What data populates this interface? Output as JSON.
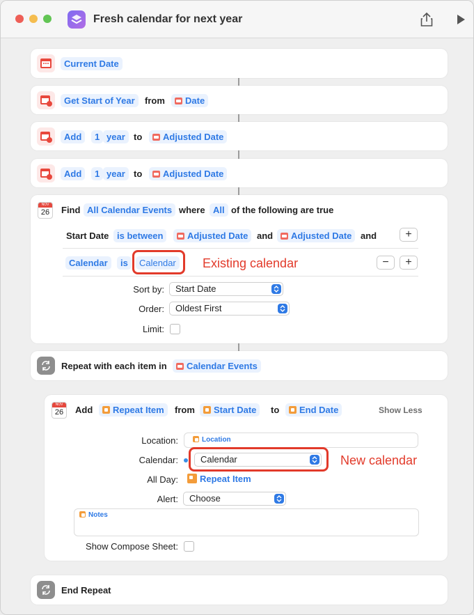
{
  "window": {
    "title": "Fresh calendar for next year"
  },
  "actions": {
    "current_date": "Current Date",
    "get_start": {
      "action": "Get Start of Year",
      "from": "from",
      "input": "Date"
    },
    "add1": {
      "add": "Add",
      "qty": "1",
      "unit": "year",
      "to": "to",
      "target": "Adjusted Date"
    },
    "add2": {
      "add": "Add",
      "qty": "1",
      "unit": "year",
      "to": "to",
      "target": "Adjusted Date"
    },
    "find": {
      "find": "Find",
      "subject": "All Calendar Events",
      "where": "where",
      "all": "All",
      "suffix": "of the following are true",
      "cond1": {
        "field": "Start Date",
        "op": "is between",
        "a": "Adjusted Date",
        "and": "and",
        "b": "Adjusted Date",
        "trail": "and"
      },
      "cond2": {
        "field": "Calendar",
        "op": "is",
        "value": "Calendar"
      },
      "sort_label": "Sort by:",
      "sort_value": "Start Date",
      "order_label": "Order:",
      "order_value": "Oldest First",
      "limit_label": "Limit:",
      "plus": "+",
      "minus": "−",
      "badge_month": "NOV",
      "badge_day": "26"
    },
    "repeat": {
      "label": "Repeat with each item in",
      "token": "Calendar Events"
    },
    "add_event": {
      "add": "Add",
      "item": "Repeat Item",
      "from": "from",
      "start": "Start Date",
      "to": "to",
      "end": "End Date",
      "show_less": "Show Less",
      "location_label": "Location:",
      "location_placeholder": "Location",
      "calendar_label": "Calendar:",
      "calendar_value": "Calendar",
      "allday_label": "All Day:",
      "allday_value": "Repeat Item",
      "alert_label": "Alert:",
      "alert_value": "Choose",
      "notes_placeholder": "Notes",
      "compose_label": "Show Compose Sheet:",
      "badge_month": "NOV",
      "badge_day": "26"
    },
    "end_repeat": "End Repeat"
  },
  "annotations": {
    "existing": "Existing calendar",
    "new": "New calendar"
  },
  "colors": {
    "accent": "#2f7ae5",
    "annotation": "#e23a2a"
  }
}
